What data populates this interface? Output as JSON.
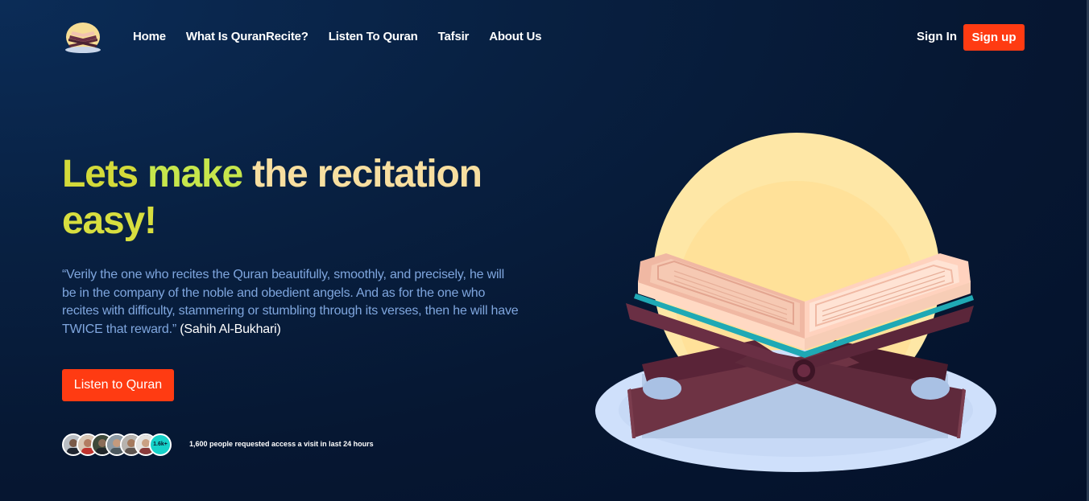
{
  "nav": {
    "logo_icon": "quran-stand-logo-icon",
    "links": [
      "Home",
      "What Is QuranRecite?",
      "Listen To Quran",
      "Tafsir",
      "About Us"
    ],
    "sign_in": "Sign In",
    "sign_up": "Sign up"
  },
  "hero": {
    "title_parts": [
      "Lets",
      "make",
      "the recitation",
      "easy!"
    ],
    "quote": "“Verily the one who recites the Quran beautifully, smoothly, and precisely, he will be in the company of the noble and obedient angels. And as for the one who recites with difficulty, stammering or stumbling through its verses, then he will have TWICE that reward.”",
    "quote_source": "(Sahih Al-Bukhari)",
    "cta": "Listen to Quran",
    "avatar_count": "1.6k+",
    "visits_text": "1,600 people requested access a visit in last 24 hours",
    "illustration_icon": "quran-on-rehal-illustration"
  },
  "colors": {
    "background": "#061732",
    "accent": "#ff3b12",
    "title_yellow": "#d3da3a",
    "title_green": "#c6e64c",
    "title_cream": "#f8dfa0",
    "quote_blue": "#7fa6de",
    "badge_teal": "#16d2c9"
  }
}
